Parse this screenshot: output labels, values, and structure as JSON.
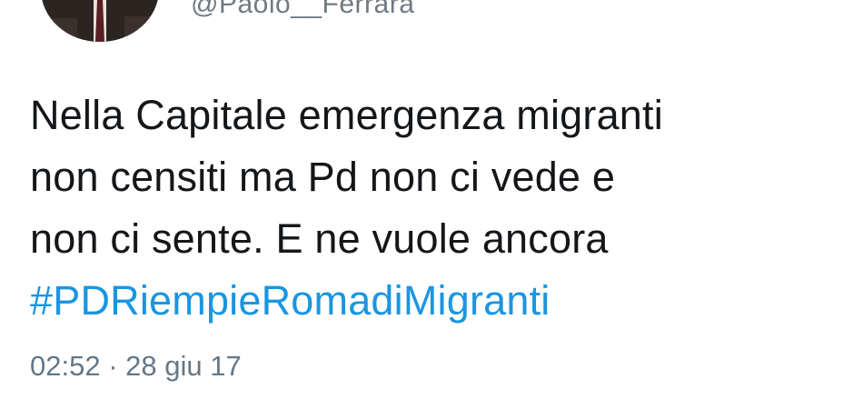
{
  "tweet": {
    "handle": "@Paolo__Ferrara",
    "text_lines": [
      "Nella Capitale emergenza migranti",
      "non censiti ma Pd non ci vede e",
      "non ci sente. E ne vuole ancora"
    ],
    "hashtag": "#PDRiempieRomadiMigranti",
    "timestamp": "02:52 · 28 giu 17"
  },
  "colors": {
    "text": "#14171a",
    "muted": "#657786",
    "link": "#1b95e0"
  }
}
